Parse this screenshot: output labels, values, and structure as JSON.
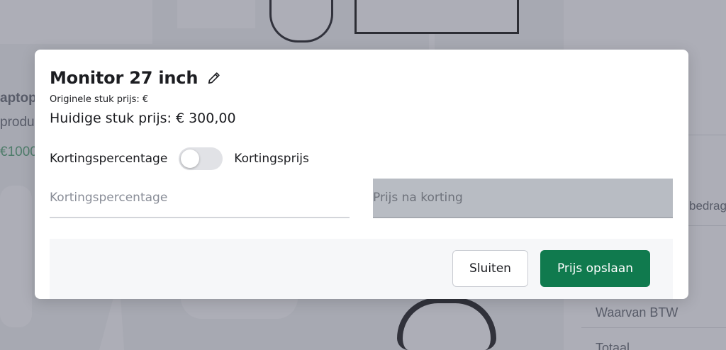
{
  "background": {
    "left_col_texts": [
      "aptop",
      "produ",
      "€1000"
    ],
    "right_col_texts": [
      "bedrag",
      "Waarvan BTW",
      "Totaal"
    ]
  },
  "modal": {
    "title": "Monitor 27 inch",
    "edit_icon": "pencil-icon",
    "original_price_label": "Originele stuk prijs: €",
    "current_price_label": "Huidige stuk prijs: € 300,00",
    "toggle": {
      "left_label": "Kortingspercentage",
      "right_label": "Kortingsprijs",
      "state": "off"
    },
    "discount_percentage_input": {
      "value": "",
      "placeholder": "Kortingspercentage"
    },
    "price_after_discount_input": {
      "value": "",
      "placeholder": "Prijs na korting"
    },
    "buttons": {
      "close": "Sluiten",
      "save": "Prijs opslaan"
    }
  },
  "colors": {
    "primary_button": "#107a4e",
    "disabled_field": "#b8bcc3",
    "overlay": "#3c4052"
  }
}
